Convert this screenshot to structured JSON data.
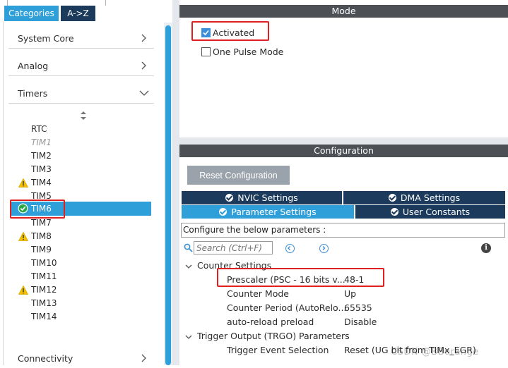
{
  "left_panel": {
    "tabs": {
      "categories": "Categories",
      "az": "A->Z"
    },
    "categories": [
      {
        "label": "System Core"
      },
      {
        "label": "Analog"
      },
      {
        "label": "Timers"
      },
      {
        "label": "Connectivity"
      }
    ],
    "timers": [
      {
        "label": "RTC",
        "state": "normal"
      },
      {
        "label": "TIM1",
        "state": "disabled"
      },
      {
        "label": "TIM2",
        "state": "normal"
      },
      {
        "label": "TIM3",
        "state": "normal"
      },
      {
        "label": "TIM4",
        "state": "warning"
      },
      {
        "label": "TIM5",
        "state": "normal"
      },
      {
        "label": "TIM6",
        "state": "selected-ok"
      },
      {
        "label": "TIM7",
        "state": "normal"
      },
      {
        "label": "TIM8",
        "state": "warning"
      },
      {
        "label": "TIM9",
        "state": "normal"
      },
      {
        "label": "TIM10",
        "state": "normal"
      },
      {
        "label": "TIM11",
        "state": "normal"
      },
      {
        "label": "TIM12",
        "state": "warning"
      },
      {
        "label": "TIM13",
        "state": "normal"
      },
      {
        "label": "TIM14",
        "state": "normal"
      }
    ]
  },
  "mode": {
    "header": "Mode",
    "activated_label": "Activated",
    "activated_checked": true,
    "one_pulse_label": "One Pulse Mode",
    "one_pulse_checked": false
  },
  "configuration": {
    "header": "Configuration",
    "reset_button": "Reset Configuration",
    "tabs": {
      "nvic": "NVIC Settings",
      "dma": "DMA Settings",
      "parameter": "Parameter Settings",
      "user": "User Constants"
    },
    "configure_text": "Configure the below parameters :",
    "search_placeholder": "Search (Ctrl+F)",
    "groups": {
      "counter": "Counter Settings",
      "trigger": "Trigger Output (TRGO) Parameters"
    },
    "params": [
      {
        "name": "Prescaler (PSC - 16 bits v...",
        "value": "48-1"
      },
      {
        "name": "Counter Mode",
        "value": "Up"
      },
      {
        "name": "Counter Period (AutoRelo...",
        "value": "65535"
      },
      {
        "name": "auto-reload preload",
        "value": "Disable"
      },
      {
        "name": "Trigger Event Selection",
        "value": "Reset (UG bit from TIMx_EGR)"
      }
    ],
    "watermark": "CSDN @BBorange"
  },
  "colors": {
    "accent_blue": "#2f9fd9",
    "navy": "#1b3a5c",
    "header_gray": "#4d5156",
    "highlight_red": "#e02020",
    "warning_yellow": "#f2c200",
    "ok_green": "#27a844"
  }
}
